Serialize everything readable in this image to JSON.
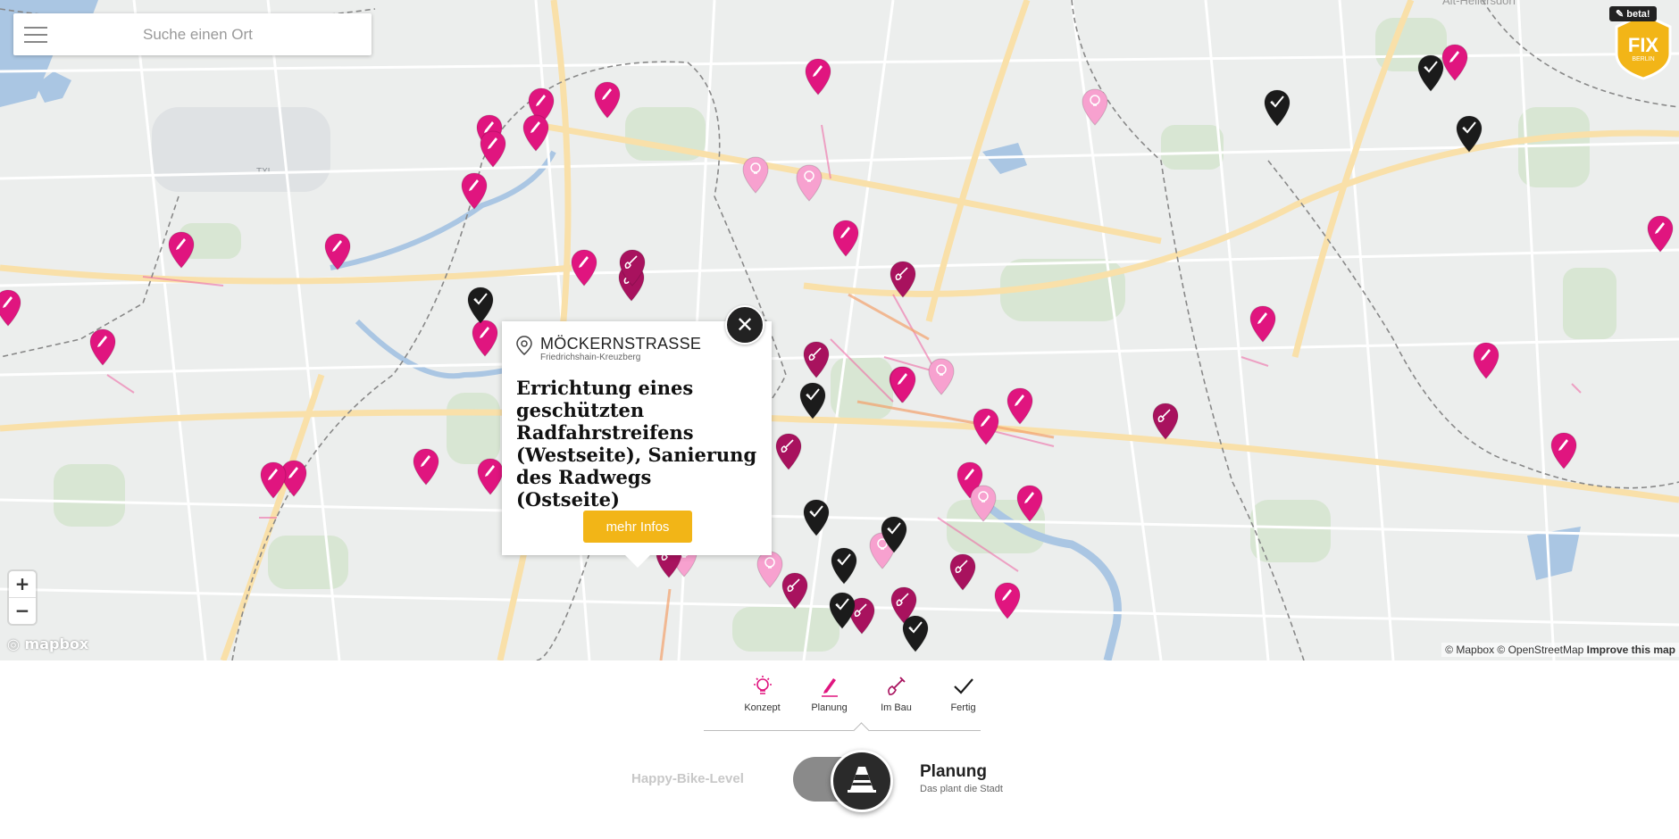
{
  "search": {
    "placeholder": "Suche einen Ort"
  },
  "logo": {
    "beta_label": "beta!",
    "text": "FIX",
    "subtext": "BERLIN"
  },
  "map": {
    "zoom_in_label": "+",
    "zoom_out_label": "−",
    "brand": "mapbox",
    "attribution": "© Mapbox © OpenStreetMap",
    "improve_label": "Improve this map",
    "area_label": "Alt-Hellersdorf",
    "airport_label": "TXL",
    "colors": {
      "planung": "#e0157f",
      "konzept": "#f7a1cf",
      "im_bau": "#a8125e",
      "fertig": "#1b1b1b"
    },
    "markers": [
      {
        "type": "planung",
        "icon": "pencil-icon"
      },
      {
        "type": "planung",
        "icon": "pencil-icon"
      },
      {
        "type": "planung",
        "icon": "pencil-icon"
      },
      {
        "type": "planung",
        "icon": "pencil-icon"
      },
      {
        "type": "planung",
        "icon": "pencil-icon"
      },
      {
        "type": "planung",
        "icon": "pencil-icon"
      },
      {
        "type": "planung",
        "icon": "pencil-icon"
      },
      {
        "type": "planung",
        "icon": "pencil-icon"
      },
      {
        "type": "planung",
        "icon": "pencil-icon"
      },
      {
        "type": "planung",
        "icon": "pencil-icon"
      },
      {
        "type": "planung",
        "icon": "pencil-icon"
      },
      {
        "type": "planung",
        "icon": "pencil-icon"
      },
      {
        "type": "planung",
        "icon": "pencil-icon"
      },
      {
        "type": "planung",
        "icon": "pencil-icon"
      },
      {
        "type": "planung",
        "icon": "pencil-icon"
      },
      {
        "type": "planung",
        "icon": "pencil-icon"
      },
      {
        "type": "planung",
        "icon": "pencil-icon"
      },
      {
        "type": "planung",
        "icon": "pencil-icon"
      },
      {
        "type": "planung",
        "icon": "pencil-icon"
      },
      {
        "type": "planung",
        "icon": "pencil-icon"
      },
      {
        "type": "planung",
        "icon": "pencil-icon"
      },
      {
        "type": "planung",
        "icon": "pencil-icon"
      },
      {
        "type": "planung",
        "icon": "pencil-icon"
      },
      {
        "type": "planung",
        "icon": "pencil-icon"
      },
      {
        "type": "planung",
        "icon": "pencil-icon"
      },
      {
        "type": "planung",
        "icon": "pencil-icon"
      },
      {
        "type": "planung",
        "icon": "pencil-icon"
      },
      {
        "type": "planung",
        "icon": "pencil-icon"
      },
      {
        "type": "planung",
        "icon": "pencil-icon"
      },
      {
        "type": "planung",
        "icon": "pencil-icon"
      },
      {
        "type": "konzept",
        "icon": "bulb-icon"
      },
      {
        "type": "konzept",
        "icon": "bulb-icon"
      },
      {
        "type": "konzept",
        "icon": "bulb-icon"
      },
      {
        "type": "konzept",
        "icon": "bulb-icon"
      },
      {
        "type": "konzept",
        "icon": "bulb-icon"
      },
      {
        "type": "konzept",
        "icon": "bulb-icon"
      },
      {
        "type": "konzept",
        "icon": "bulb-icon"
      },
      {
        "type": "konzept",
        "icon": "bulb-icon"
      },
      {
        "type": "im_bau",
        "icon": "shovel-icon"
      },
      {
        "type": "im_bau",
        "icon": "shovel-icon"
      },
      {
        "type": "im_bau",
        "icon": "shovel-icon"
      },
      {
        "type": "im_bau",
        "icon": "shovel-icon"
      },
      {
        "type": "im_bau",
        "icon": "shovel-icon"
      },
      {
        "type": "im_bau",
        "icon": "shovel-icon"
      },
      {
        "type": "im_bau",
        "icon": "shovel-icon"
      },
      {
        "type": "im_bau",
        "icon": "shovel-icon"
      },
      {
        "type": "im_bau",
        "icon": "shovel-icon"
      },
      {
        "type": "im_bau",
        "icon": "shovel-icon"
      },
      {
        "type": "im_bau",
        "icon": "shovel-icon"
      },
      {
        "type": "fertig",
        "icon": "check-icon"
      },
      {
        "type": "fertig",
        "icon": "check-icon"
      },
      {
        "type": "fertig",
        "icon": "check-icon"
      },
      {
        "type": "fertig",
        "icon": "check-icon"
      },
      {
        "type": "fertig",
        "icon": "check-icon"
      },
      {
        "type": "fertig",
        "icon": "check-icon"
      },
      {
        "type": "fertig",
        "icon": "check-icon"
      },
      {
        "type": "fertig",
        "icon": "check-icon"
      },
      {
        "type": "fertig",
        "icon": "check-icon"
      },
      {
        "type": "fertig",
        "icon": "check-icon"
      }
    ]
  },
  "popup": {
    "street": "MÖCKERNSTRASSE",
    "district": "Friedrichshain-Kreuzberg",
    "title": "Errichtung eines geschützten Radfahrstreifens (Westseite), Sanierung des Radwegs (Ostseite)",
    "button_label": "mehr Infos",
    "close_label": "✕"
  },
  "legend": {
    "items": [
      {
        "label": "Konzept",
        "icon": "bulb-icon",
        "color": "#e0157f"
      },
      {
        "label": "Planung",
        "icon": "pencil-icon",
        "color": "#e0157f"
      },
      {
        "label": "Im Bau",
        "icon": "shovel-icon",
        "color": "#a8125e"
      },
      {
        "label": "Fertig",
        "icon": "check-icon",
        "color": "#1b1b1b"
      }
    ]
  },
  "level": {
    "left_label": "Happy-Bike-Level",
    "current": "Planung",
    "current_sub": "Das plant die Stadt",
    "toggle_icon": "traffic-cone-icon"
  }
}
